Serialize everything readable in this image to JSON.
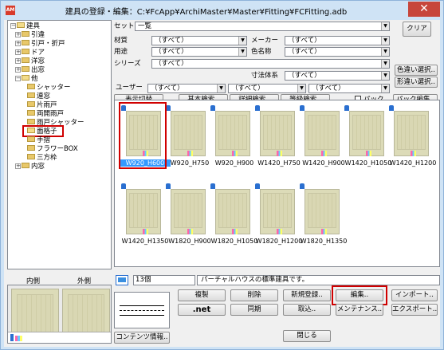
{
  "window": {
    "title": "建具の登録・編集：C:¥FcApp¥ArchiMaster¥Master¥Fitting¥FCFitting.adb",
    "app_icon": "AM",
    "close": "✕"
  },
  "tree": {
    "nodes": [
      {
        "label": "建具",
        "expander": "−"
      },
      {
        "label": "引違",
        "expander": "+"
      },
      {
        "label": "引戸・折戸",
        "expander": "+"
      },
      {
        "label": "ドア",
        "expander": "+"
      },
      {
        "label": "洋窓",
        "expander": "+"
      },
      {
        "label": "出窓",
        "expander": "+"
      },
      {
        "label": "他",
        "expander": "−"
      },
      {
        "label": "シャッター",
        "expander": ""
      },
      {
        "label": "連窓",
        "expander": ""
      },
      {
        "label": "片雨戸",
        "expander": ""
      },
      {
        "label": "両開雨戸",
        "expander": ""
      },
      {
        "label": "雨戸シャッター",
        "expander": ""
      },
      {
        "label": "面格子",
        "expander": ""
      },
      {
        "label": "手摺",
        "expander": ""
      },
      {
        "label": "フラワーBOX",
        "expander": ""
      },
      {
        "label": "三方枠",
        "expander": ""
      },
      {
        "label": "内窓",
        "expander": "+"
      }
    ]
  },
  "filters": {
    "set_label": "セット",
    "set_value": "一覧",
    "clear": "クリア",
    "material_label": "材質",
    "material_value": "（すべて）",
    "maker_label": "メーカー",
    "maker_value": "（すべて）",
    "use_label": "用途",
    "use_value": "（すべて）",
    "color_label": "色名称",
    "color_value": "（すべて）",
    "series_label": "シリーズ",
    "series_value": "（すべて）",
    "dimsys_label": "寸法体系",
    "dimsys_value": "（すべて）",
    "color_variant": "色違い選択..",
    "shape_variant": "形違い選択..",
    "user_label": "ユーザー",
    "user_values": [
      "（すべて）",
      "（すべて）",
      "（すべて）"
    ]
  },
  "toolbar": {
    "display_switch": "表示切替",
    "basic_search": "基本検索..",
    "detail_search": "詳細検索..",
    "grade_search": "等級検索..",
    "pack_check": "パック",
    "pack_edit": "パック編集.."
  },
  "items": [
    {
      "name": "W920_H600",
      "selected": true
    },
    {
      "name": "W920_H750"
    },
    {
      "name": "W920_H900"
    },
    {
      "name": "W1420_H750"
    },
    {
      "name": "W1420_H900"
    },
    {
      "name": "W1420_H1050"
    },
    {
      "name": "W1420_H1200"
    },
    {
      "name": "W1420_H1350"
    },
    {
      "name": "W1820_H900"
    },
    {
      "name": "W1820_H1050"
    },
    {
      "name": "W1820_H1200"
    },
    {
      "name": "W1820_H1350"
    }
  ],
  "status": {
    "count": "13個",
    "description": "パーチャルハウスの標準建具です。"
  },
  "preview": {
    "inside": "内側",
    "outside": "外側",
    "content_info": "コンテンツ情報.."
  },
  "actions": {
    "copy": "複製",
    "delete": "削除",
    "new_register": "新規登録..",
    "edit": "編集..",
    "import": "インポート..",
    "net": ".net",
    "sync": "同期",
    "fetch": "取込..",
    "maintenance": "メンテナンス..",
    "export": "エクスポート..",
    "close": "閉じる"
  }
}
